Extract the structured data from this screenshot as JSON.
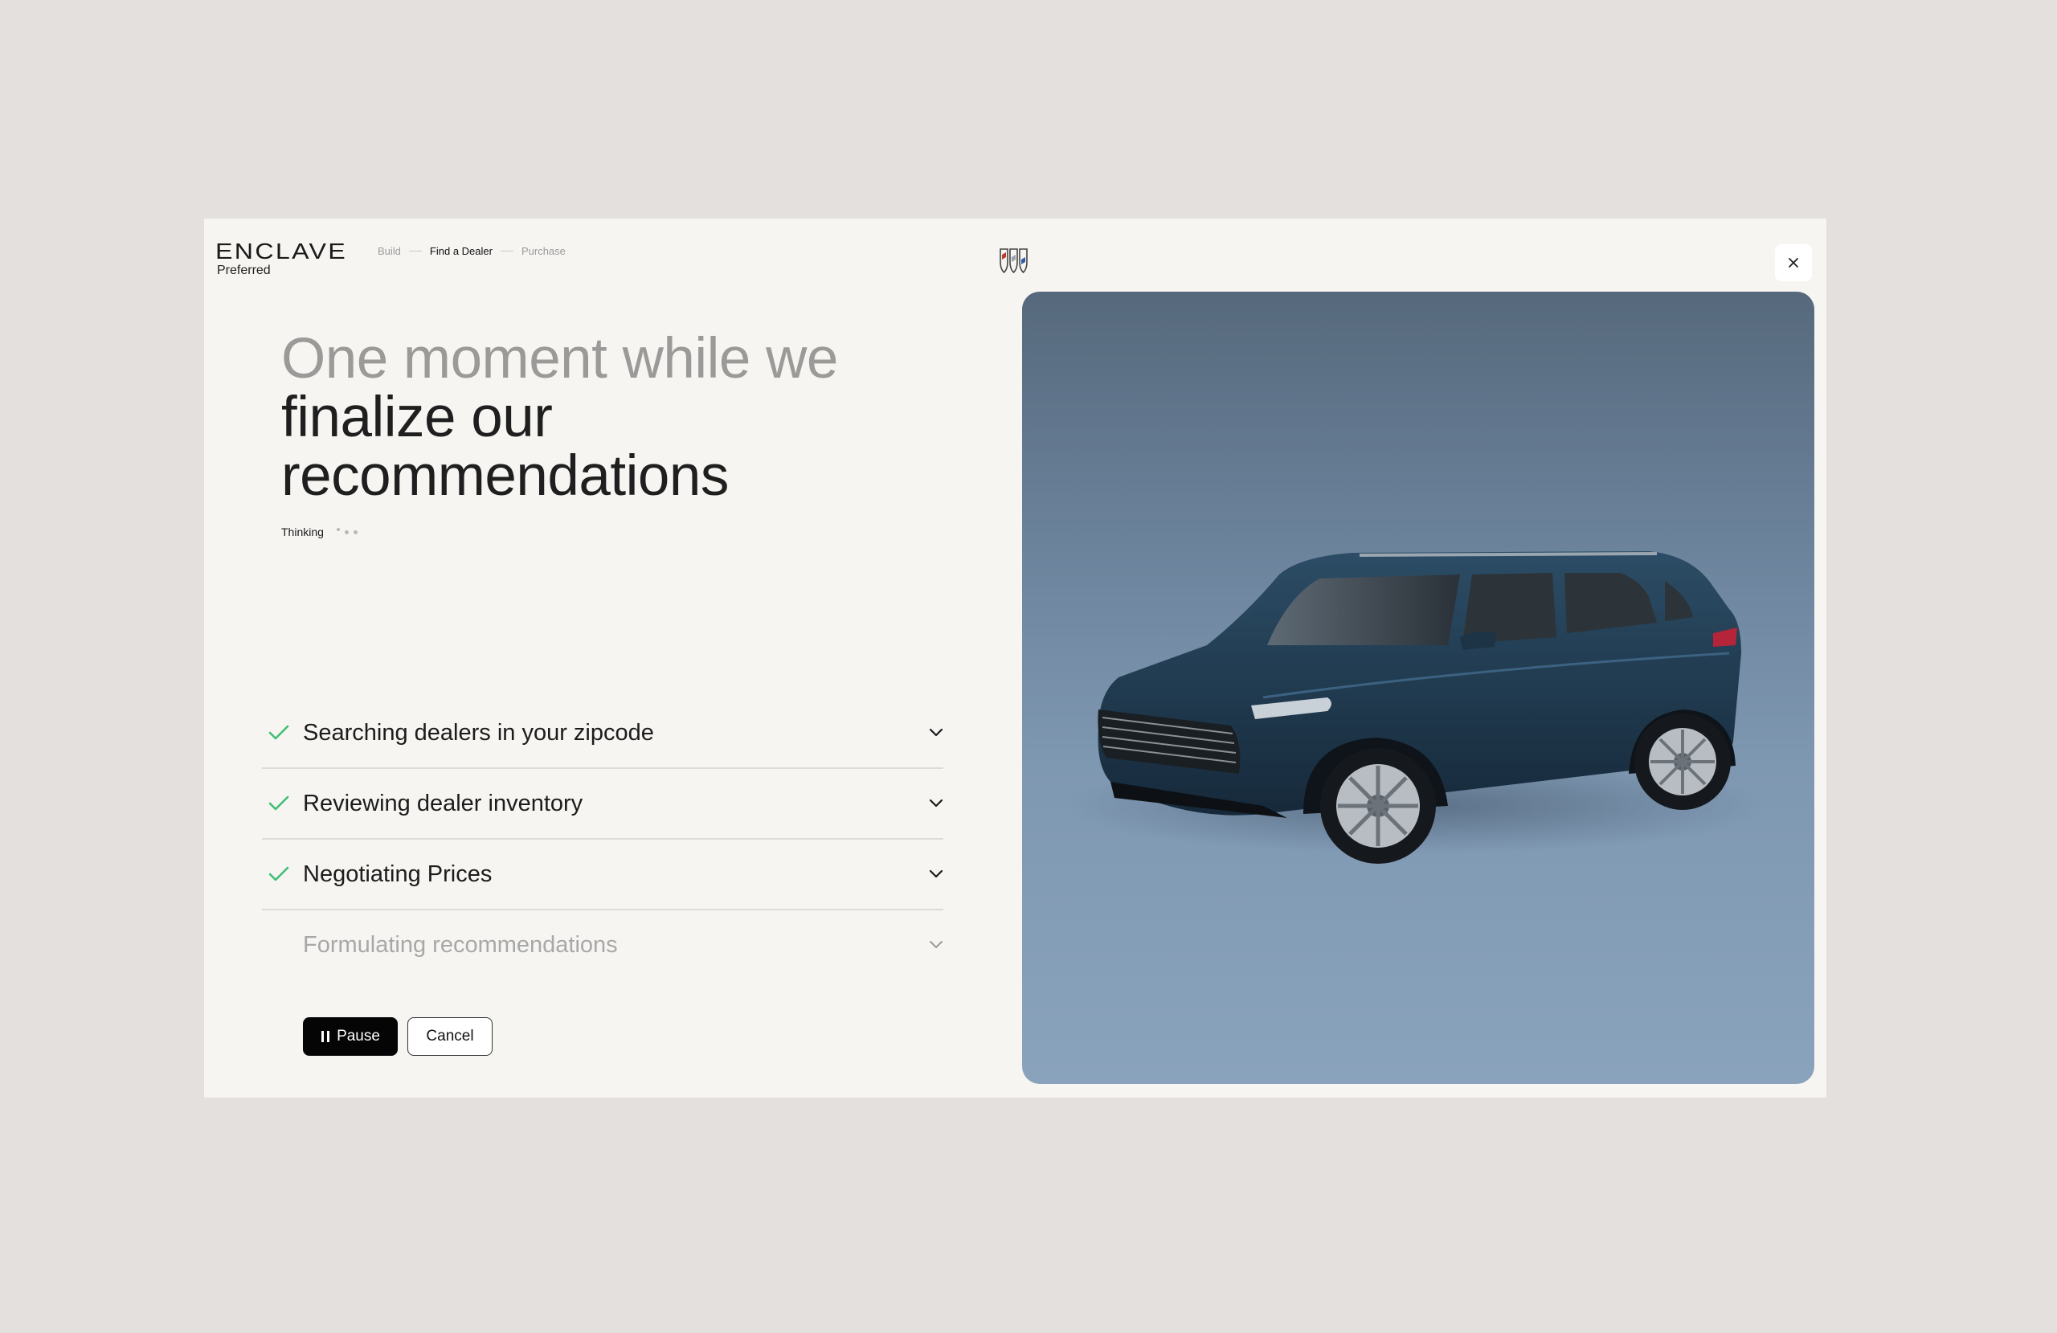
{
  "header": {
    "logo_text": "ENCLAVE",
    "logo_sub": "Preferred",
    "steps": [
      "Build",
      "Find a Dealer",
      "Purchase"
    ],
    "active_step": "Find a Dealer"
  },
  "headline": {
    "muted_part": "One moment while we",
    "strong_part": "finalize our recommendations"
  },
  "status": {
    "label": "Thinking"
  },
  "tasks": [
    {
      "label": "Searching dealers in your zipcode",
      "done": true
    },
    {
      "label": "Reviewing dealer inventory",
      "done": true
    },
    {
      "label": "Negotiating Prices",
      "done": true
    },
    {
      "label": "Formulating recommendations",
      "done": false
    }
  ],
  "buttons": {
    "pause": "Pause",
    "cancel": "Cancel"
  },
  "colors": {
    "check": "#3fbf74",
    "primary": "#050505",
    "background": "#f6f5f2",
    "car_panel": "#7f98b2"
  },
  "icons": {
    "close": "close-icon",
    "check": "check-icon",
    "chevron": "chevron-down-icon",
    "pause": "pause-icon"
  }
}
